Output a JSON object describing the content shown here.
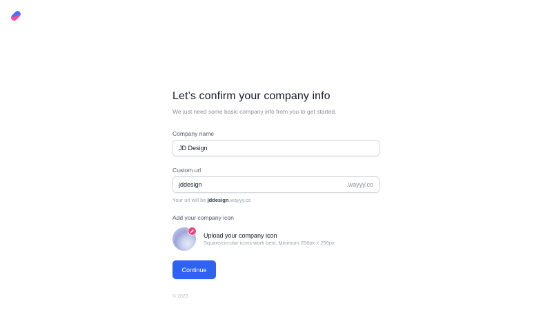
{
  "header": {
    "logo_icon": "brand-logo-icon",
    "logo_colors": [
      "#ff4fa0",
      "#3b6cf6"
    ]
  },
  "form": {
    "title": "Let’s confirm your company info",
    "subtitle": "We just need some basic company info from you to get started.",
    "company_name": {
      "label": "Company name",
      "value": "JD Design"
    },
    "custom_url": {
      "label": "Custom url",
      "value": "jddesign",
      "suffix": ".wayyy.co",
      "hint_prefix": "Your url will be ",
      "hint_bold": "jddesign",
      "hint_suffix": ".wayyy.co"
    },
    "company_icon": {
      "label": "Add your company icon",
      "upload_title": "Upload your company icon",
      "upload_desc": "Square/circular icons work best. Minimum 256px x 256px",
      "edit_icon": "pencil-icon",
      "badge_color": "#e8457f"
    },
    "continue_label": "Continue",
    "accent": "#2f62f0"
  },
  "footer": {
    "copyright": "© 2023"
  }
}
